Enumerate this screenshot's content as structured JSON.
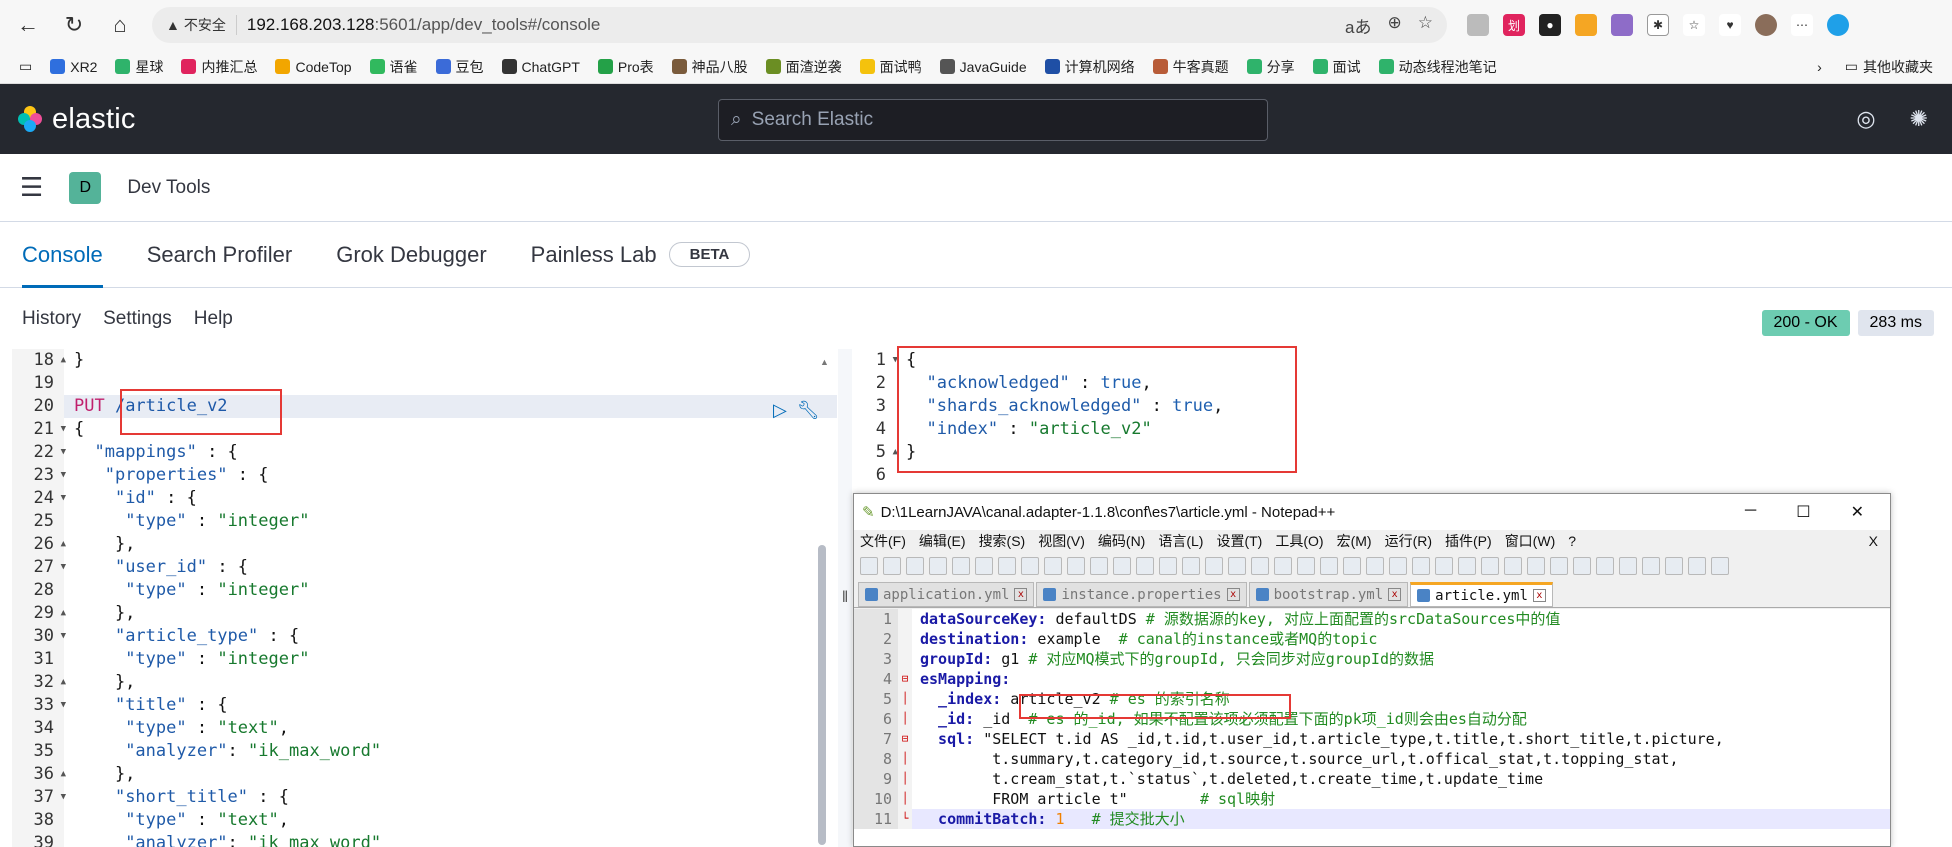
{
  "browser": {
    "insecure_label": "不安全",
    "url_host": "192.168.203.128",
    "url_path": ":5601/app/dev_tools#/console"
  },
  "bookmarks": [
    {
      "label": "XR2",
      "color": "#2f6fde"
    },
    {
      "label": "星球",
      "color": "#2fb36b"
    },
    {
      "label": "内推汇总",
      "color": "#e0245e"
    },
    {
      "label": "CodeTop",
      "color": "#f2a600"
    },
    {
      "label": "语雀",
      "color": "#31b95e"
    },
    {
      "label": "豆包",
      "color": "#3b6bd8"
    },
    {
      "label": "ChatGPT",
      "color": "#333333"
    },
    {
      "label": "Pro表",
      "color": "#24a148"
    },
    {
      "label": "神品八股",
      "color": "#7a5b3c"
    },
    {
      "label": "面渣逆袭",
      "color": "#6b8e23"
    },
    {
      "label": "面试鸭",
      "color": "#f4c20d"
    },
    {
      "label": "JavaGuide",
      "color": "#555555"
    },
    {
      "label": "计算机网络",
      "color": "#1f4fa5"
    },
    {
      "label": "牛客真题",
      "color": "#b85c38"
    },
    {
      "label": "分享",
      "color": "#2fb36b"
    },
    {
      "label": "面试",
      "color": "#2fb36b"
    },
    {
      "label": "动态线程池笔记",
      "color": "#2fb36b"
    }
  ],
  "bookmarks_more": "其他收藏夹",
  "kibana": {
    "logo": "elastic",
    "search_placeholder": "Search Elastic",
    "space_initial": "D",
    "breadcrumb": "Dev Tools"
  },
  "tabs": [
    {
      "label": "Console",
      "active": true
    },
    {
      "label": "Search Profiler",
      "active": false
    },
    {
      "label": "Grok Debugger",
      "active": false
    },
    {
      "label": "Painless Lab",
      "active": false
    }
  ],
  "beta_label": "BETA",
  "toolbar": {
    "history": "History",
    "settings": "Settings",
    "help": "Help"
  },
  "status": {
    "code": "200 - OK",
    "time": "283 ms"
  },
  "editor_lines": [
    {
      "n": "18",
      "fold": "▲",
      "html": "}"
    },
    {
      "n": "19",
      "fold": "",
      "html": ""
    },
    {
      "n": "20",
      "fold": "",
      "html": "PUT /article_v2",
      "method": "PUT",
      "path": " /article_v2",
      "hl": true
    },
    {
      "n": "21",
      "fold": "▼",
      "html": "{"
    },
    {
      "n": "22",
      "fold": "▼",
      "k": "\"mappings\"",
      "rest": " : {",
      "indent": "  "
    },
    {
      "n": "23",
      "fold": "▼",
      "k": "\"properties\"",
      "rest": " : {",
      "indent": "   "
    },
    {
      "n": "24",
      "fold": "▼",
      "k": "\"id\"",
      "rest": " : {",
      "indent": "    "
    },
    {
      "n": "25",
      "fold": "",
      "k": "\"type\"",
      "rest": " : ",
      "s": "\"integer\"",
      "indent": "     "
    },
    {
      "n": "26",
      "fold": "▲",
      "html": "    },"
    },
    {
      "n": "27",
      "fold": "▼",
      "k": "\"user_id\"",
      "rest": " : {",
      "indent": "    "
    },
    {
      "n": "28",
      "fold": "",
      "k": "\"type\"",
      "rest": " : ",
      "s": "\"integer\"",
      "indent": "     "
    },
    {
      "n": "29",
      "fold": "▲",
      "html": "    },"
    },
    {
      "n": "30",
      "fold": "▼",
      "k": "\"article_type\"",
      "rest": " : {",
      "indent": "    "
    },
    {
      "n": "31",
      "fold": "",
      "k": "\"type\"",
      "rest": " : ",
      "s": "\"integer\"",
      "indent": "     "
    },
    {
      "n": "32",
      "fold": "▲",
      "html": "    },"
    },
    {
      "n": "33",
      "fold": "▼",
      "k": "\"title\"",
      "rest": " : {",
      "indent": "    "
    },
    {
      "n": "34",
      "fold": "",
      "k": "\"type\"",
      "rest": " : ",
      "s": "\"text\"",
      "tail": ",",
      "indent": "     "
    },
    {
      "n": "35",
      "fold": "",
      "k": "\"analyzer\"",
      "rest": ": ",
      "s": "\"ik_max_word\"",
      "indent": "     "
    },
    {
      "n": "36",
      "fold": "▲",
      "html": "    },"
    },
    {
      "n": "37",
      "fold": "▼",
      "k": "\"short_title\"",
      "rest": " : {",
      "indent": "    "
    },
    {
      "n": "38",
      "fold": "",
      "k": "\"type\"",
      "rest": " : ",
      "s": "\"text\"",
      "tail": ",",
      "indent": "     "
    },
    {
      "n": "39",
      "fold": "",
      "k": "\"analyzer\"",
      "rest": ": ",
      "s": "\"ik_max_word\"",
      "indent": "     "
    }
  ],
  "output_lines": [
    {
      "n": "1",
      "fold": "▼",
      "html": "{"
    },
    {
      "n": "2",
      "fold": "",
      "k": "\"acknowledged\"",
      "rest": " : ",
      "b": "true",
      "tail": ",",
      "indent": "  "
    },
    {
      "n": "3",
      "fold": "",
      "k": "\"shards_acknowledged\"",
      "rest": " : ",
      "b": "true",
      "tail": ",",
      "indent": "  "
    },
    {
      "n": "4",
      "fold": "",
      "k": "\"index\"",
      "rest": " : ",
      "s": "\"article_v2\"",
      "indent": "  "
    },
    {
      "n": "5",
      "fold": "▲",
      "html": "}"
    },
    {
      "n": "6",
      "fold": "",
      "html": ""
    }
  ],
  "notepad": {
    "title": "D:\\1LearnJAVA\\canal.adapter-1.1.8\\conf\\es7\\article.yml - Notepad++",
    "menu": [
      "文件(F)",
      "编辑(E)",
      "搜索(S)",
      "视图(V)",
      "编码(N)",
      "语言(L)",
      "设置(T)",
      "工具(O)",
      "宏(M)",
      "运行(R)",
      "插件(P)",
      "窗口(W)",
      "?"
    ],
    "close_menu": "X",
    "tabs": [
      {
        "label": "application.yml",
        "active": false
      },
      {
        "label": "instance.properties",
        "active": false
      },
      {
        "label": "bootstrap.yml",
        "active": false
      },
      {
        "label": "article.yml",
        "active": true
      }
    ],
    "lines": [
      {
        "n": "1",
        "fold": "",
        "key": "dataSourceKey:",
        "val": " defaultDS",
        "cmt": " # 源数据源的key, 对应上面配置的srcDataSources中的值"
      },
      {
        "n": "2",
        "fold": "",
        "key": "destination:",
        "val": " example",
        "cmt": "  # canal的instance或者MQ的topic"
      },
      {
        "n": "3",
        "fold": "",
        "key": "groupId:",
        "val": " g1",
        "cmt": " # 对应MQ模式下的groupId, 只会同步对应groupId的数据"
      },
      {
        "n": "4",
        "fold": "⊟",
        "key": "esMapping:",
        "val": "",
        "cmt": ""
      },
      {
        "n": "5",
        "fold": "│",
        "key": "  _index:",
        "val": " article_v2",
        "cmt": " # es 的索引名称"
      },
      {
        "n": "6",
        "fold": "│",
        "key": "  _id:",
        "val": " _id",
        "cmt": "  # es 的_id, 如果不配置该项必须配置下面的pk项_id则会由es自动分配"
      },
      {
        "n": "7",
        "fold": "⊟",
        "key": "  sql:",
        "val": " \"SELECT t.id AS _id,t.id,t.user_id,t.article_type,t.title,t.short_title,t.picture,",
        "cmt": ""
      },
      {
        "n": "8",
        "fold": "│",
        "key": "",
        "val": "        t.summary,t.category_id,t.source,t.source_url,t.offical_stat,t.topping_stat,",
        "cmt": ""
      },
      {
        "n": "9",
        "fold": "│",
        "key": "",
        "val": "        t.cream_stat,t.`status`,t.deleted,t.create_time,t.update_time",
        "cmt": ""
      },
      {
        "n": "10",
        "fold": "│",
        "key": "",
        "val": "        FROM article t\"",
        "cmt": "        # sql映射"
      },
      {
        "n": "11",
        "fold": "└",
        "key": "  commitBatch:",
        "val": " 1",
        "cmt": "   # 提交批大小",
        "num": true,
        "cur": true
      }
    ]
  }
}
